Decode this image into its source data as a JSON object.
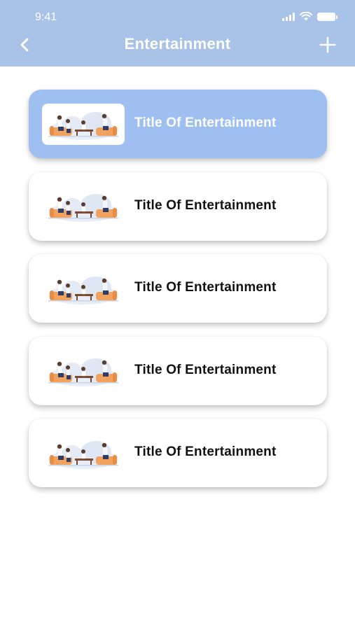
{
  "status_bar": {
    "time": "9:41"
  },
  "header": {
    "title": "Entertainment",
    "back_icon": "chevron-left-icon",
    "add_icon": "plus-icon"
  },
  "colors": {
    "header_bg": "#a9c3e8",
    "active_card_bg": "#9fbff0",
    "card_bg": "#ffffff",
    "title_text": "#111111"
  },
  "items": [
    {
      "title": "Title Of Entertainment",
      "active": true,
      "thumbnail": "friends-on-sofa-illustration"
    },
    {
      "title": "Title Of Entertainment",
      "active": false,
      "thumbnail": "friends-on-sofa-illustration"
    },
    {
      "title": "Title Of Entertainment",
      "active": false,
      "thumbnail": "friends-on-sofa-illustration"
    },
    {
      "title": "Title Of Entertainment",
      "active": false,
      "thumbnail": "friends-on-sofa-illustration"
    },
    {
      "title": "Title Of Entertainment",
      "active": false,
      "thumbnail": "friends-on-sofa-illustration"
    }
  ]
}
